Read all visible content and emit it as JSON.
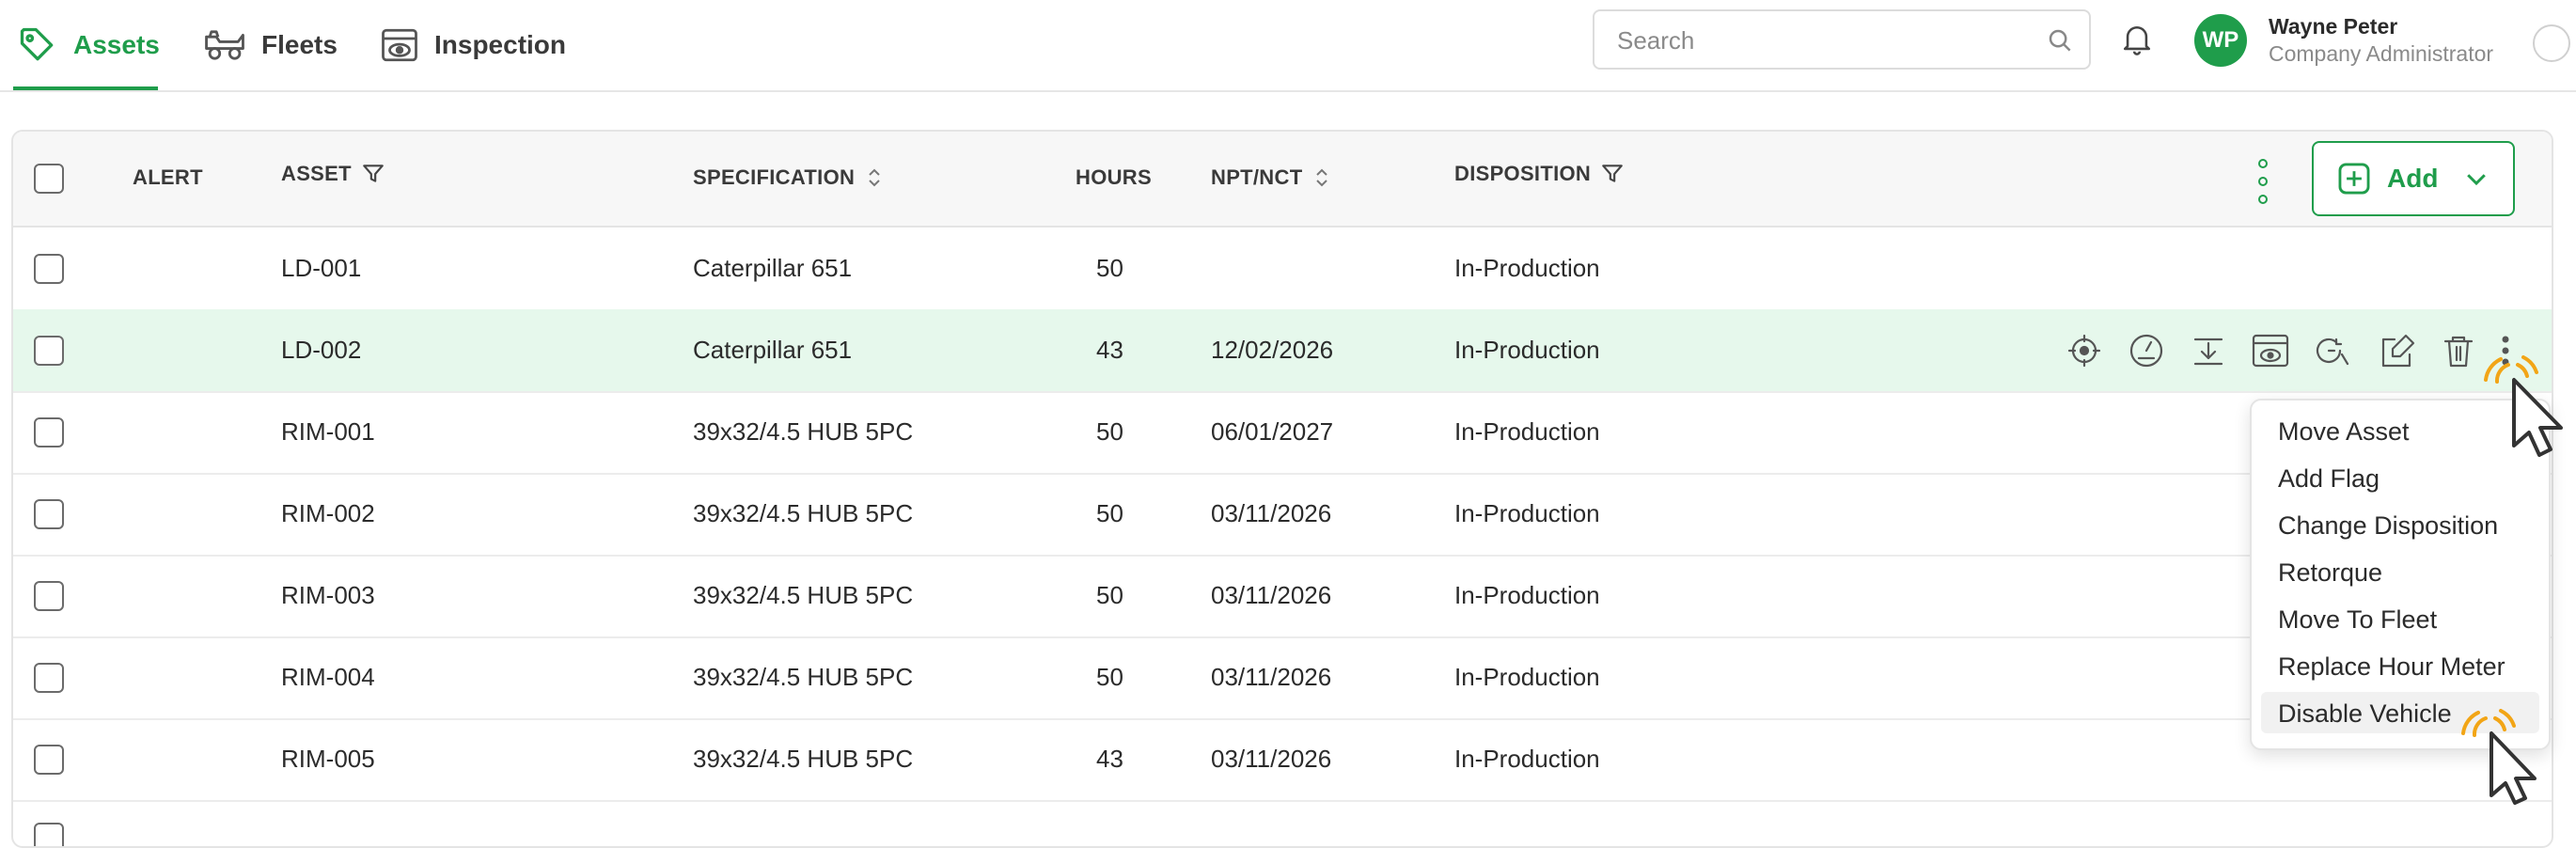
{
  "nav": {
    "tabs": [
      {
        "label": "Assets",
        "icon": "tag-icon",
        "active": true
      },
      {
        "label": "Fleets",
        "icon": "truck-icon",
        "active": false
      },
      {
        "label": "Inspection",
        "icon": "inspection-icon",
        "active": false
      }
    ],
    "accent_color": "#1f9d4b"
  },
  "search": {
    "placeholder": "Search",
    "value": ""
  },
  "user": {
    "initials": "WP",
    "name": "Wayne Peter",
    "role": "Company Administrator"
  },
  "table": {
    "columns": {
      "alert": "ALERT",
      "asset": "ASSET",
      "specification": "SPECIFICATION",
      "hours": "HOURS",
      "npt": "NPT/NCT",
      "disposition": "DISPOSITION"
    },
    "add_label": "Add",
    "rows": [
      {
        "asset": "LD-001",
        "specification": "Caterpillar 651",
        "hours": "50",
        "npt": "",
        "disposition": "In-Production"
      },
      {
        "asset": "LD-002",
        "specification": "Caterpillar 651",
        "hours": "43",
        "npt": "12/02/2026",
        "disposition": "In-Production",
        "highlighted": true
      },
      {
        "asset": "RIM-001",
        "specification": "39x32/4.5 HUB 5PC",
        "hours": "50",
        "npt": "06/01/2027",
        "disposition": "In-Production"
      },
      {
        "asset": "RIM-002",
        "specification": "39x32/4.5 HUB 5PC",
        "hours": "50",
        "npt": "03/11/2026",
        "disposition": "In-Production"
      },
      {
        "asset": "RIM-003",
        "specification": "39x32/4.5 HUB 5PC",
        "hours": "50",
        "npt": "03/11/2026",
        "disposition": "In-Production"
      },
      {
        "asset": "RIM-004",
        "specification": "39x32/4.5 HUB 5PC",
        "hours": "50",
        "npt": "03/11/2026",
        "disposition": "In-Production"
      },
      {
        "asset": "RIM-005",
        "specification": "39x32/4.5 HUB 5PC",
        "hours": "43",
        "npt": "03/11/2026",
        "disposition": "In-Production"
      }
    ],
    "row_action_icons": [
      "locate-icon",
      "gauge-icon",
      "download-tray-icon",
      "inspection-icon",
      "hour-meter-icon",
      "edit-icon",
      "trash-icon",
      "more-vertical-icon"
    ]
  },
  "context_menu": {
    "items": [
      {
        "label": "Move Asset"
      },
      {
        "label": "Add Flag"
      },
      {
        "label": "Change Disposition"
      },
      {
        "label": "Retorque"
      },
      {
        "label": "Move To Fleet"
      },
      {
        "label": "Replace Hour Meter"
      },
      {
        "label": "Disable Vehicle",
        "hovered": true
      }
    ]
  }
}
